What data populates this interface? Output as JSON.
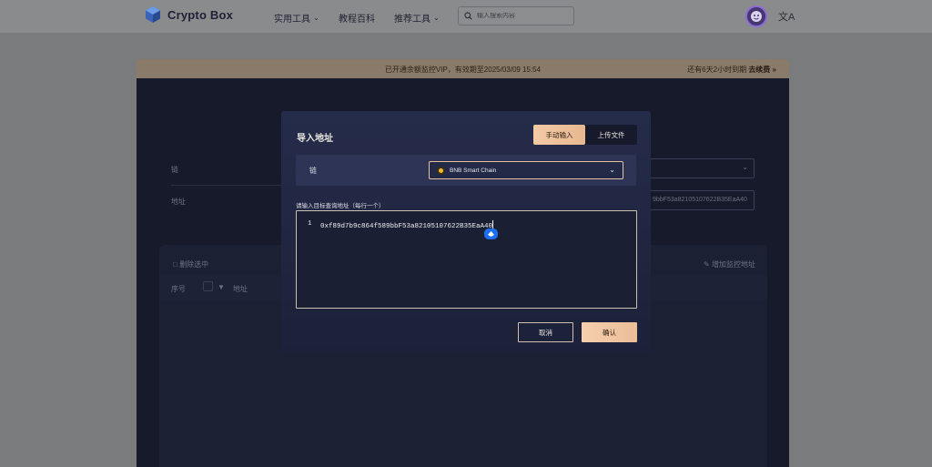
{
  "app": {
    "name": "Crypto Box"
  },
  "nav": {
    "items": [
      {
        "label": "实用工具",
        "has_dropdown": true
      },
      {
        "label": "教程百科",
        "has_dropdown": false
      },
      {
        "label": "推荐工具",
        "has_dropdown": true
      }
    ],
    "search_placeholder": "输入搜索内容",
    "lang_glyph": "文A"
  },
  "vip": {
    "notice": "已开通余额监控VIP，有效期至2025/03/09 15:54",
    "remaining": "还有6天2小时到期",
    "renew_label": "去续费",
    "renew_arrow": "»"
  },
  "background": {
    "chain_label": "链",
    "address_label": "地址",
    "address_value": "9bbF53a82105107622B35EaA40",
    "delete_label": "删除选中",
    "add_label": "增加监控地址",
    "col_index": "序号",
    "col_address": "地址"
  },
  "modal": {
    "title": "导入地址",
    "tabs": [
      {
        "label": "手动输入",
        "active": true
      },
      {
        "label": "上传文件",
        "active": false
      }
    ],
    "chain_label": "链",
    "chain_selected": "BNB Smart Chain",
    "hint": "请输入目标查询地址（每行一个）",
    "lines": [
      {
        "no": "1",
        "text": "0xf89d7b9c864f589bbF53a82105107622B35EaA40"
      }
    ],
    "cancel_label": "取消",
    "confirm_label": "确认"
  },
  "colors": {
    "accent": "#EBBD98",
    "modal_bg": "#252C4A",
    "bnb": "#F3BA2F",
    "badge_blue": "#1D6FF0"
  }
}
